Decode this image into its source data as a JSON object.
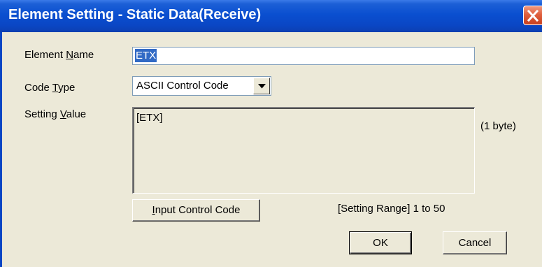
{
  "window": {
    "title": "Element Setting - Static Data(Receive)"
  },
  "form": {
    "element_name": {
      "label_prefix": "Element ",
      "label_access": "N",
      "label_suffix": "ame",
      "value": "ETX"
    },
    "code_type": {
      "label_prefix": "Code ",
      "label_access": "T",
      "label_suffix": "ype",
      "selected": "ASCII Control Code"
    },
    "setting_value": {
      "label_prefix": "Setting ",
      "label_access": "V",
      "label_suffix": "alue",
      "value": "[ETX]",
      "byte_count": "(1 byte)"
    },
    "setting_range": "[Setting Range] 1 to 50"
  },
  "buttons": {
    "input_control_code": {
      "access": "I",
      "rest": "nput Control Code"
    },
    "ok": "OK",
    "cancel": "Cancel"
  }
}
